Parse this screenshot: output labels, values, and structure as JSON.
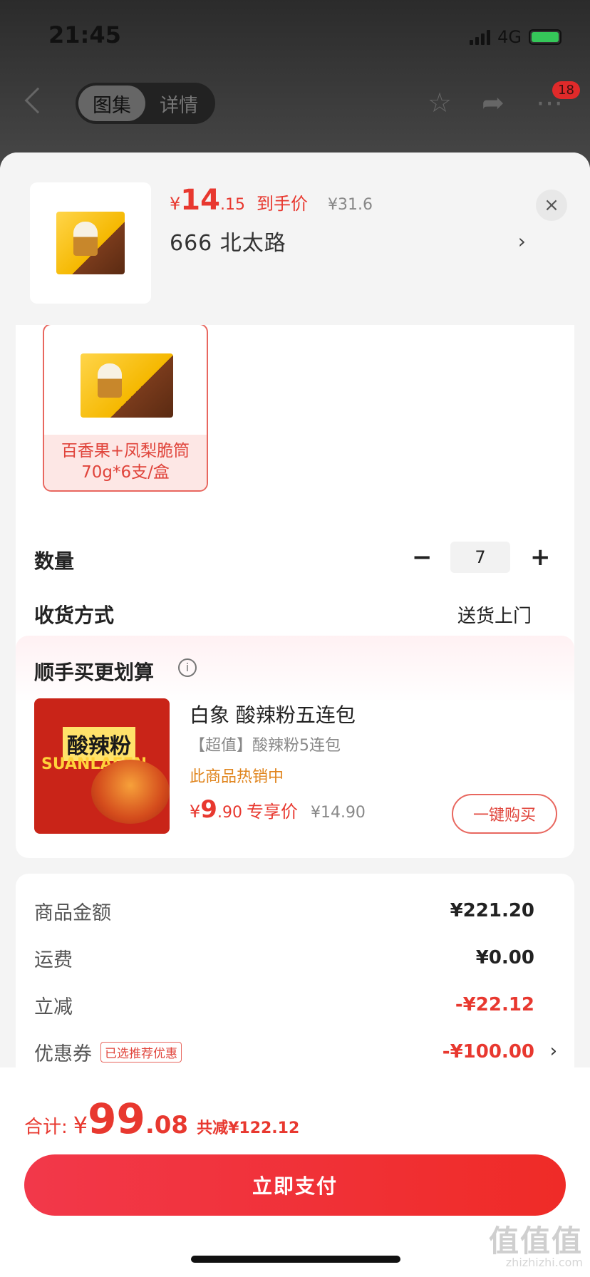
{
  "status_bar": {
    "time": "21:45",
    "network": "4G"
  },
  "nav": {
    "tabs": [
      {
        "label": "图集"
      },
      {
        "label": "详情"
      }
    ],
    "badge_count": "18"
  },
  "header": {
    "price_yen": "¥",
    "price_int": "14",
    "price_dec": ".15",
    "price_tag": "到手价",
    "original_price": "¥31.6",
    "sku": "666  北太路",
    "close_icon": "×"
  },
  "spec": {
    "variant_label": "百香果+凤梨脆筒 70g*6支/盒",
    "quantity_label": "数量",
    "quantity_value": "7",
    "minus": "−",
    "plus": "+",
    "delivery_label": "收货方式",
    "delivery_value": "送货上门"
  },
  "upsell": {
    "title": "顺手买更划算",
    "product_name": "白象 酸辣粉五连包",
    "product_sub": "【超值】酸辣粉5连包",
    "hot_text": "此商品热销中",
    "price_yen": "¥",
    "price_int": "9",
    "price_dec": ".90",
    "price_tag": "专享价",
    "original_price": "¥14.90",
    "buy_label": "一键购买"
  },
  "summary": {
    "rows": [
      {
        "label": "商品金额",
        "value": "¥221.20"
      },
      {
        "label": "运费",
        "value": "¥0.00"
      },
      {
        "label": "立减",
        "value": "-¥22.12"
      },
      {
        "label": "优惠券",
        "value": "-¥100.00",
        "tag": "已选推荐优惠"
      }
    ]
  },
  "footer": {
    "total_label": "合计:",
    "total_yen": "¥",
    "total_int": "99",
    "total_dec": ".08",
    "total_saved": "共减¥122.12",
    "pay_label": "立即支付"
  },
  "watermark": {
    "main": "值值值",
    "sub": "zhizhizhi.com"
  },
  "colors": {
    "accent": "#e8382f",
    "pay_button": "#ef2b27",
    "hot": "#e0851e"
  }
}
